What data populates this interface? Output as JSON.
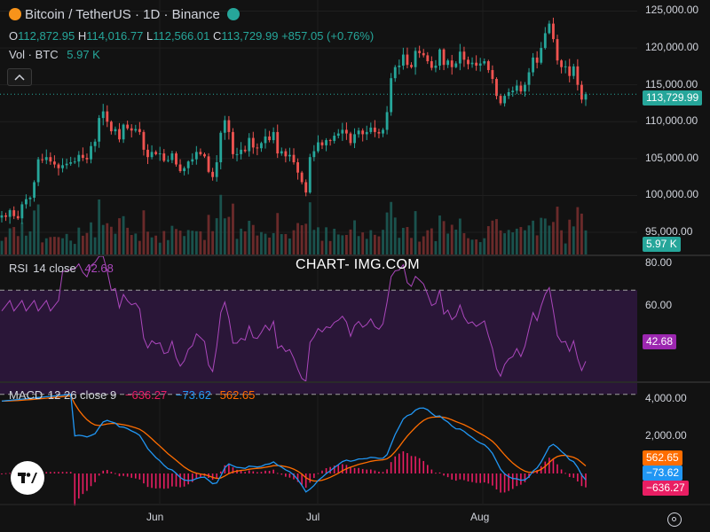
{
  "header": {
    "symbol_title": "Bitcoin / TetherUS · 1D · Binance",
    "ohlc": {
      "o_label": "O",
      "o_value": "112,872.95",
      "h_label": "H",
      "h_value": "114,016.77",
      "l_label": "L",
      "l_value": "112,566.01",
      "c_label": "C",
      "c_value": "113,729.99",
      "change": "+857.05 (+0.76%)"
    },
    "volume_label": "Vol · BTC",
    "volume_value": "5.97 K"
  },
  "badges": {
    "last_price": "113,729.99",
    "volume": "5.97 K",
    "rsi": "42.68",
    "macd_signal": "562.65",
    "macd_line": "−73.62",
    "macd_hist": "−636.27"
  },
  "rsi_panel": {
    "label": "RSI",
    "params": "14 close",
    "value": "42.68"
  },
  "macd_panel": {
    "label": "MACD",
    "params": "12 26 close 9",
    "hist": "−636.27",
    "macd": "−73.62",
    "signal": "562.65"
  },
  "watermark": "CHART- IMG.COM",
  "colors": {
    "up": "#26a69a",
    "down": "#ef5350",
    "rsi": "#ab47bc",
    "macd": "#2196f3",
    "signal": "#ff6d00",
    "hist": "#e91e63",
    "background": "#121212"
  },
  "chart_data": [
    {
      "type": "candlestick",
      "title": "Bitcoin / TetherUS · 1D · Binance",
      "ylim": [
        92000,
        126500
      ],
      "y_ticks": [
        95000,
        100000,
        105000,
        110000,
        115000,
        120000,
        125000
      ],
      "y_tick_labels": [
        "95,000.00",
        "100,000.00",
        "105,000.00",
        "110,000.00",
        "115,000.00",
        "120,000.00",
        "125,000.00"
      ],
      "x_tick_labels": [
        "Jun",
        "Jul",
        "Aug"
      ],
      "last_price": 113729.99,
      "closes": [
        97300,
        97100,
        98000,
        97200,
        96900,
        98800,
        99500,
        99700,
        101800,
        104900,
        104800,
        105200,
        104600,
        104200,
        103700,
        104100,
        104300,
        104500,
        104600,
        105500,
        105100,
        104900,
        106700,
        107300,
        110500,
        111400,
        110000,
        108700,
        109000,
        107600,
        109600,
        109100,
        108800,
        109000,
        108600,
        106200,
        105200,
        105900,
        105600,
        105700,
        104700,
        104800,
        105700,
        104200,
        103300,
        103700,
        104600,
        104900,
        105900,
        105600,
        105300,
        103200,
        102500,
        104500,
        108500,
        110200,
        108600,
        105600,
        105600,
        106200,
        106000,
        107800,
        106500,
        106400,
        107100,
        108000,
        107500,
        108600,
        105700,
        106000,
        105300,
        105500,
        104500,
        103100,
        101800,
        100400,
        105200,
        106000,
        107200,
        106800,
        107500,
        107400,
        108100,
        108400,
        108900,
        108400,
        107100,
        108300,
        108800,
        108300,
        108600,
        109200,
        108600,
        108400,
        108900,
        111300,
        115900,
        117400,
        117600,
        119100,
        117700,
        117400,
        119600,
        119300,
        119000,
        118200,
        117300,
        117600,
        119800,
        117700,
        118300,
        117400,
        117900,
        119500,
        118400,
        117800,
        118000,
        117600,
        117900,
        118200,
        117000,
        115800,
        113500,
        112500,
        113500,
        114000,
        114200,
        114900,
        114100,
        115000,
        116700,
        118700,
        118000,
        120000,
        122000,
        123300,
        121200,
        118300,
        117400,
        117500,
        116200,
        117500,
        115000,
        113000,
        113730
      ],
      "volume_unit": "BTC",
      "volume_last": 5.97
    },
    {
      "type": "line",
      "title": "RSI 14 close",
      "ylim": [
        35,
        83
      ],
      "y_ticks": [
        60,
        80
      ],
      "y_tick_labels": [
        "60.00",
        "80.00"
      ],
      "bands": [
        30,
        70
      ],
      "last_value": 42.68
    },
    {
      "type": "line",
      "title": "MACD 12 26 close 9",
      "ylim": [
        -1500,
        4500
      ],
      "y_ticks": [
        2000,
        4000
      ],
      "y_tick_labels": [
        "2,000.00",
        "4,000.00"
      ],
      "series": [
        {
          "name": "MACD",
          "last": -73.62
        },
        {
          "name": "signal",
          "last": 562.65
        },
        {
          "name": "histogram",
          "last": -636.27
        }
      ]
    }
  ]
}
